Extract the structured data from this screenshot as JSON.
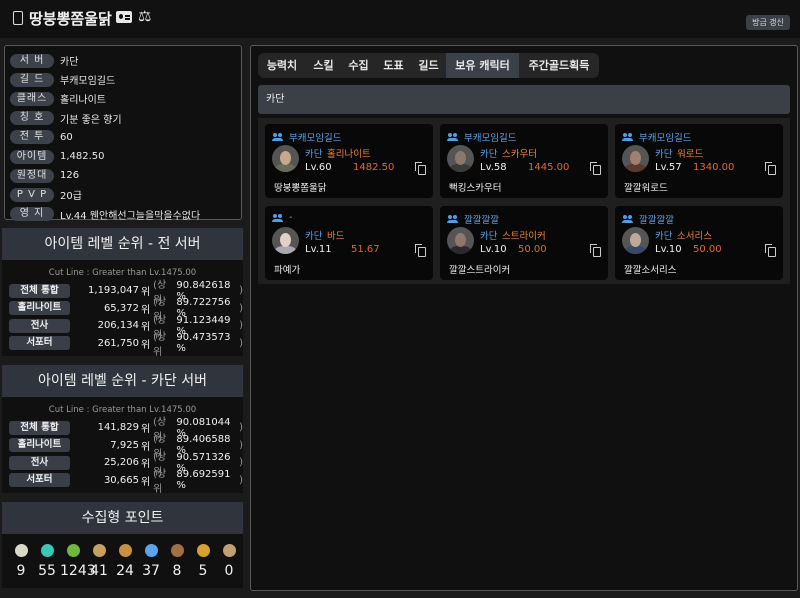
{
  "header": {
    "character_name": "땅붕뽕쫌울닭",
    "refresh_label": "방금 갱신"
  },
  "info": [
    {
      "label": "서 버",
      "value": "카단"
    },
    {
      "label": "길 드",
      "value": "부캐모임길드"
    },
    {
      "label": "클래스",
      "value": "홀리나이트"
    },
    {
      "label": "칭 호",
      "value": "기분 좋은 향기"
    },
    {
      "label": "전 투",
      "value": "60"
    },
    {
      "label": "아이템",
      "value": "1,482.50"
    },
    {
      "label": "원정대",
      "value": "126"
    },
    {
      "label": "P V P",
      "value": "20급"
    },
    {
      "label": "영 지",
      "value": "Lv.44 웬안해선그늘을막을수없다"
    }
  ],
  "rank_all": {
    "title": "아이템 레벨 순위 - 전 서버",
    "cutline": "Cut Line : Greater than Lv.1475.00",
    "rows": [
      {
        "label": "전체 통합",
        "num": "1,193,047",
        "pct": "90.842618"
      },
      {
        "label": "홀리나이트",
        "num": "65,372",
        "pct": "89.722756"
      },
      {
        "label": "전사",
        "num": "206,134",
        "pct": "91.123449"
      },
      {
        "label": "서포터",
        "num": "261,750",
        "pct": "90.473573"
      }
    ]
  },
  "rank_server": {
    "title": "아이템 레벨 순위 - 카단 서버",
    "cutline": "Cut Line : Greater than Lv.1475.00",
    "rows": [
      {
        "label": "전체 통합",
        "num": "141,829",
        "pct": "90.081044"
      },
      {
        "label": "홀리나이트",
        "num": "7,925",
        "pct": "89.406588"
      },
      {
        "label": "전사",
        "num": "25,206",
        "pct": "90.571326"
      },
      {
        "label": "서포터",
        "num": "30,665",
        "pct": "89.692591"
      }
    ]
  },
  "rank_text": {
    "pos": "위",
    "open": "(상위",
    "pct_sign": "%",
    "close": ")"
  },
  "collect": {
    "title": "수집형 포인트",
    "items": [
      {
        "icon": "mokoko-seed-icon",
        "color": "#d9d9c8",
        "count": "9"
      },
      {
        "icon": "island-heart-icon",
        "color": "#38c8b8",
        "count": "55"
      },
      {
        "icon": "giant-heart-icon",
        "color": "#6fb83c",
        "count": "1243"
      },
      {
        "icon": "masterpiece-icon",
        "color": "#c8a060",
        "count": "41"
      },
      {
        "icon": "adventure-book-icon",
        "color": "#c89040",
        "count": "24"
      },
      {
        "icon": "voyage-icon",
        "color": "#5aa5ea",
        "count": "37"
      },
      {
        "icon": "world-tree-leaf-icon",
        "color": "#a07040",
        "count": "8"
      },
      {
        "icon": "orpheus-star-icon",
        "color": "#d8a030",
        "count": "5"
      },
      {
        "icon": "igneas-token-icon",
        "color": "#c0a070",
        "count": "0"
      }
    ]
  },
  "tabs": [
    "능력치",
    "스킬",
    "수집",
    "도표",
    "길드",
    "보유 캐릭터",
    "주간골드획득"
  ],
  "active_tab": 5,
  "server_section": "카단",
  "characters": [
    {
      "guild": "부캐모임길드",
      "server": "카단",
      "class": "홀리나이트",
      "level": "Lv.60",
      "ilvl": "1482.50",
      "name": "땅붕뽕쫌울닭",
      "skin": "#c8a888",
      "cloth": "#6a6a5a"
    },
    {
      "guild": "부캐모임길드",
      "server": "카단",
      "class": "스카우터",
      "level": "Lv.58",
      "ilvl": "1445.00",
      "name": "뻑킹스카우터",
      "skin": "#8a7868",
      "cloth": "#3a3a3a"
    },
    {
      "guild": "부캐모임길드",
      "server": "카단",
      "class": "워로드",
      "level": "Lv.57",
      "ilvl": "1340.00",
      "name": "깔깔워로드",
      "skin": "#a08070",
      "cloth": "#5a3a2a"
    },
    {
      "guild": "-",
      "server": "카단",
      "class": "바드",
      "level": "Lv.11",
      "ilvl": "51.67",
      "name": "파예가",
      "skin": "#e0d0c8",
      "cloth": "#a8a8b0"
    },
    {
      "guild": "깔깔깔깔",
      "server": "카단",
      "class": "스트라이커",
      "level": "Lv.10",
      "ilvl": "50.00",
      "name": "깔깔스트라이커",
      "skin": "#907868",
      "cloth": "#2a2a30"
    },
    {
      "guild": "깔깔깔깔",
      "server": "카단",
      "class": "소서리스",
      "level": "Lv.10",
      "ilvl": "50.00",
      "name": "깔깔소서리스",
      "skin": "#c0a898",
      "cloth": "#384868"
    }
  ]
}
